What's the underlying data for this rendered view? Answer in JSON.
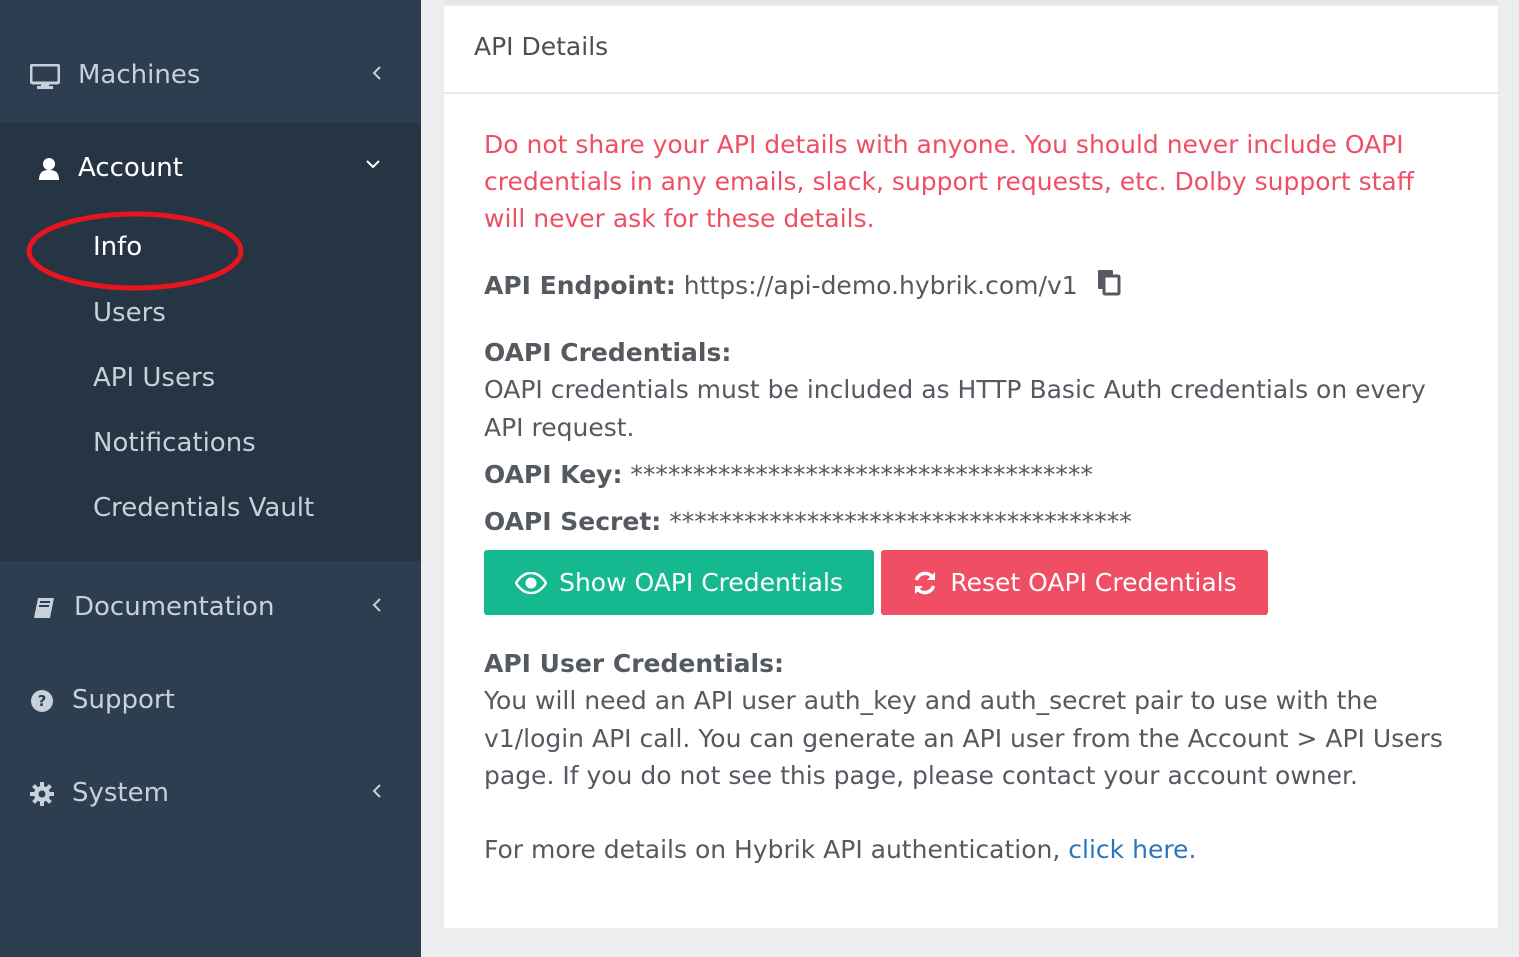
{
  "sidebar": {
    "items": [
      {
        "label": "Machines",
        "icon": "desktop-icon"
      },
      {
        "label": "Account",
        "icon": "user-icon"
      },
      {
        "label": "Documentation",
        "icon": "book-icon"
      },
      {
        "label": "Support",
        "icon": "question-circle-icon"
      },
      {
        "label": "System",
        "icon": "gear-icon"
      }
    ],
    "account_sub": [
      "Info",
      "Users",
      "API Users",
      "Notifications",
      "Credentials Vault"
    ],
    "active_sub": "Info"
  },
  "panel": {
    "title": "API Details",
    "warning": "Do not share your API details with anyone. You should never include OAPI credentials in any emails, slack, support requests, etc. Dolby support staff will never ask for these details.",
    "endpoint_label": "API Endpoint:",
    "endpoint_value": "https://api-demo.hybrik.com/v1",
    "oapi_heading": "OAPI Credentials:",
    "oapi_desc": "OAPI credentials must be included as HTTP Basic Auth credentials on every API request.",
    "key_label": "OAPI Key:",
    "key_value": "*************************************",
    "secret_label": "OAPI Secret:",
    "secret_value": "*************************************",
    "show_button": "Show OAPI Credentials",
    "reset_button": "Reset OAPI Credentials",
    "api_user_heading": "API User Credentials:",
    "api_user_desc": "You will need an API user auth_key and auth_secret pair to use with the v1/login API call. You can generate an API user from the Account > API Users page. If you do not see this page, please contact your account owner.",
    "more_text": "For more details on Hybrik API authentication,",
    "more_link": "click here."
  },
  "colors": {
    "sidebar_bg": "#2c3e50",
    "warning": "#ef4f64",
    "show_button": "#16b890",
    "reset_button": "#f04e64",
    "link": "#2a76bd"
  }
}
